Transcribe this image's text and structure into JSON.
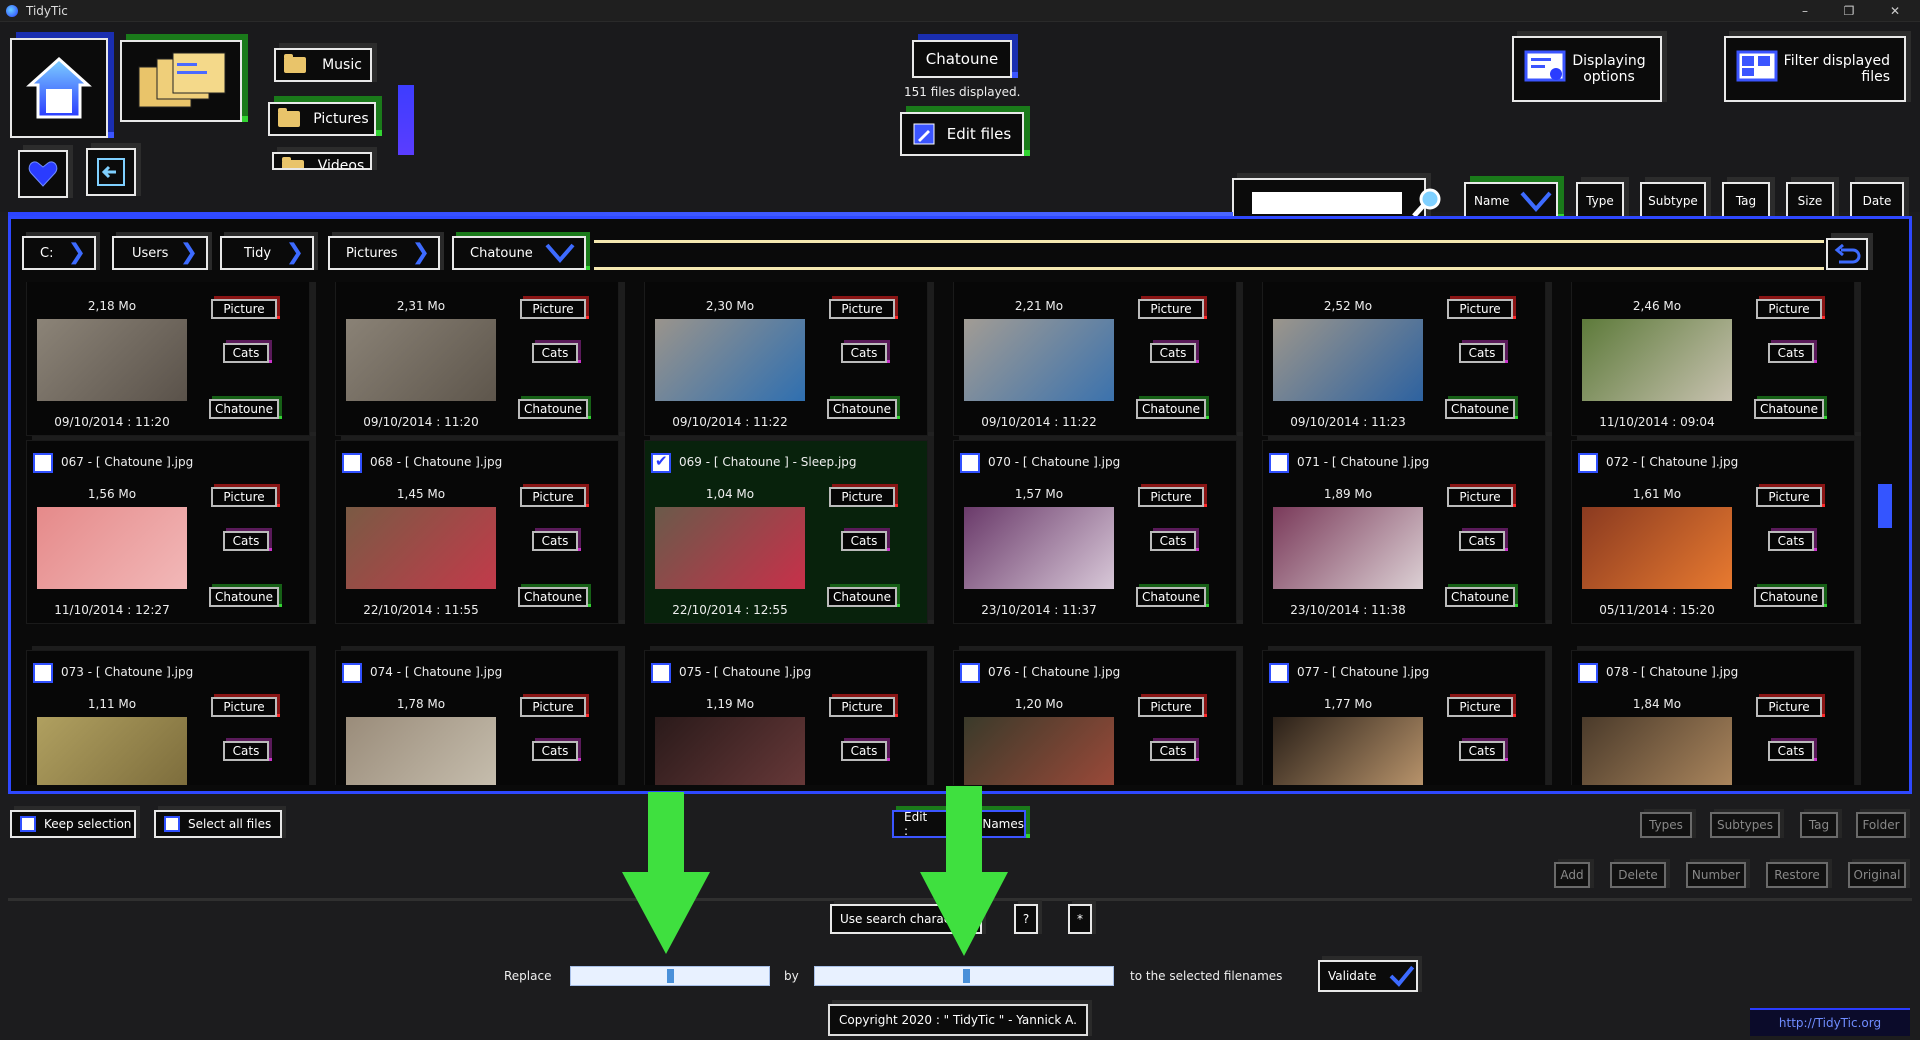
{
  "window": {
    "title": "TidyTic",
    "controls": [
      "–",
      "❐",
      "✕"
    ]
  },
  "nav": {
    "music_label": "Music",
    "pictures_label": "Pictures",
    "videos_label": "Videos"
  },
  "folder": {
    "name": "Chatoune",
    "count_text": "151 files displayed.",
    "edit_label": "Edit files"
  },
  "options": {
    "displaying": "Displaying options",
    "filter": "Filter displayed files"
  },
  "sort": {
    "name": "Name",
    "type": "Type",
    "subtype": "Subtype",
    "tag": "Tag",
    "size": "Size",
    "date": "Date"
  },
  "breadcrumb": [
    "C:",
    "Users",
    "Tidy",
    "Pictures",
    "Chatoune"
  ],
  "files": [
    {
      "name": "",
      "size": "2,18 Mo",
      "date": "09/10/2014 : 11:20",
      "type": "Picture",
      "subtype": "Cats",
      "tag": "Chatoune",
      "selected": false,
      "colors": [
        "#8c8478",
        "#5a524a"
      ]
    },
    {
      "name": "",
      "size": "2,31 Mo",
      "date": "09/10/2014 : 11:20",
      "type": "Picture",
      "subtype": "Cats",
      "tag": "Chatoune",
      "selected": false,
      "colors": [
        "#8a8276",
        "#5e564c"
      ]
    },
    {
      "name": "",
      "size": "2,30 Mo",
      "date": "09/10/2014 : 11:22",
      "type": "Picture",
      "subtype": "Cats",
      "tag": "Chatoune",
      "selected": false,
      "colors": [
        "#9a948c",
        "#2f6fb0"
      ]
    },
    {
      "name": "",
      "size": "2,21 Mo",
      "date": "09/10/2014 : 11:22",
      "type": "Picture",
      "subtype": "Cats",
      "tag": "Chatoune",
      "selected": false,
      "colors": [
        "#a29c94",
        "#3b72ad"
      ]
    },
    {
      "name": "",
      "size": "2,52 Mo",
      "date": "09/10/2014 : 11:23",
      "type": "Picture",
      "subtype": "Cats",
      "tag": "Chatoune",
      "selected": false,
      "colors": [
        "#9c968c",
        "#2d62a0"
      ]
    },
    {
      "name": "",
      "size": "2,46 Mo",
      "date": "11/10/2014 : 09:04",
      "type": "Picture",
      "subtype": "Cats",
      "tag": "Chatoune",
      "selected": false,
      "colors": [
        "#5d7a3a",
        "#c8c2b0"
      ]
    },
    {
      "name": "067 - [ Chatoune ].jpg",
      "size": "1,56 Mo",
      "date": "11/10/2014 : 12:27",
      "type": "Picture",
      "subtype": "Cats",
      "tag": "Chatoune",
      "selected": false,
      "colors": [
        "#e58a8a",
        "#f2b8b8"
      ]
    },
    {
      "name": "068 - [ Chatoune ].jpg",
      "size": "1,45 Mo",
      "date": "22/10/2014 : 11:55",
      "type": "Picture",
      "subtype": "Cats",
      "tag": "Chatoune",
      "selected": false,
      "colors": [
        "#7a5a44",
        "#c23a4a"
      ]
    },
    {
      "name": "069 - [ Chatoune ] - Sleep.jpg",
      "size": "1,04 Mo",
      "date": "22/10/2014 : 12:55",
      "type": "Picture",
      "subtype": "Cats",
      "tag": "Chatoune",
      "selected": true,
      "colors": [
        "#6a5a4a",
        "#c8304a"
      ]
    },
    {
      "name": "070 - [ Chatoune ].jpg",
      "size": "1,57 Mo",
      "date": "23/10/2014 : 11:37",
      "type": "Picture",
      "subtype": "Cats",
      "tag": "Chatoune",
      "selected": false,
      "colors": [
        "#6a3a6a",
        "#d8c8d8"
      ]
    },
    {
      "name": "071 - [ Chatoune ].jpg",
      "size": "1,89 Mo",
      "date": "23/10/2014 : 11:38",
      "type": "Picture",
      "subtype": "Cats",
      "tag": "Chatoune",
      "selected": false,
      "colors": [
        "#7a3a5a",
        "#dcd0d4"
      ]
    },
    {
      "name": "072 - [ Chatoune ].jpg",
      "size": "1,61 Mo",
      "date": "05/11/2014 : 15:20",
      "type": "Picture",
      "subtype": "Cats",
      "tag": "Chatoune",
      "selected": false,
      "colors": [
        "#8a3a20",
        "#e87a30"
      ]
    },
    {
      "name": "073 - [ Chatoune ].jpg",
      "size": "1,11 Mo",
      "date": "",
      "type": "Picture",
      "subtype": "Cats",
      "tag": "",
      "selected": false,
      "colors": [
        "#b0a060",
        "#7a6a3a"
      ]
    },
    {
      "name": "074 - [ Chatoune ].jpg",
      "size": "1,78 Mo",
      "date": "",
      "type": "Picture",
      "subtype": "Cats",
      "tag": "",
      "selected": false,
      "colors": [
        "#9a8c7a",
        "#c8c0b0"
      ]
    },
    {
      "name": "075 - [ Chatoune ].jpg",
      "size": "1,19 Mo",
      "date": "",
      "type": "Picture",
      "subtype": "Cats",
      "tag": "",
      "selected": false,
      "colors": [
        "#2a1a1a",
        "#6a3a3a"
      ]
    },
    {
      "name": "076 - [ Chatoune ].jpg",
      "size": "1,20 Mo",
      "date": "",
      "type": "Picture",
      "subtype": "Cats",
      "tag": "",
      "selected": false,
      "colors": [
        "#3a3a2a",
        "#a04a3a"
      ]
    },
    {
      "name": "077 - [ Chatoune ].jpg",
      "size": "1,77 Mo",
      "date": "",
      "type": "Picture",
      "subtype": "Cats",
      "tag": "",
      "selected": false,
      "colors": [
        "#2a2018",
        "#c09a70"
      ]
    },
    {
      "name": "078 - [ Chatoune ].jpg",
      "size": "1,84 Mo",
      "date": "",
      "type": "Picture",
      "subtype": "Cats",
      "tag": "",
      "selected": false,
      "colors": [
        "#4a3a2a",
        "#b08a60"
      ]
    }
  ],
  "selection": {
    "keep": "Keep selection",
    "select_all": "Select all files"
  },
  "edit": {
    "prefix": "Edit :",
    "mode": "Names"
  },
  "edit_modes": [
    "Types",
    "Subtypes",
    "Tag",
    "Folder"
  ],
  "name_actions": [
    "Add",
    "Delete",
    "Number",
    "Restore",
    "Original"
  ],
  "search_chars": {
    "label": "Use search charac",
    "q": "?",
    "star": "*"
  },
  "replace": {
    "replace_label": "Replace",
    "by_label": "by",
    "suffix": "to the selected filenames",
    "validate": "Validate",
    "replace_value": "",
    "by_value": ""
  },
  "footer": {
    "copyright": "Copyright 2020 : \" TidyTic \" - Yannick A.",
    "url": "http://TidyTic.org"
  }
}
